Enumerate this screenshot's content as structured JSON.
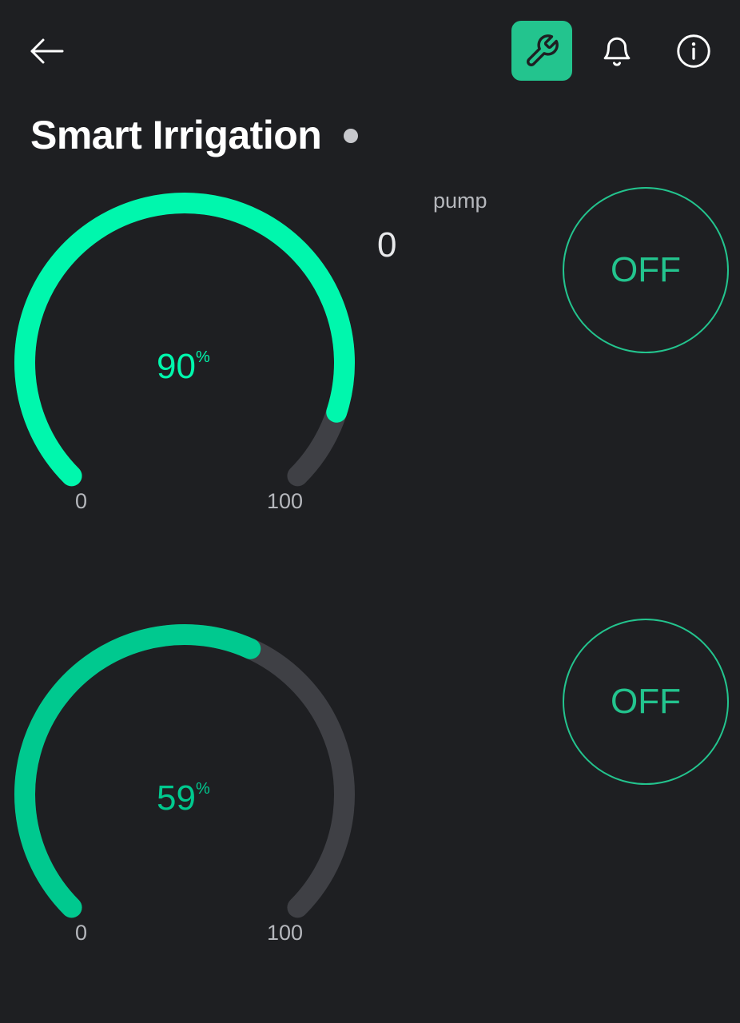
{
  "header": {
    "back_icon": "arrow-left-icon",
    "settings_icon": "wrench-icon",
    "notifications_icon": "bell-icon",
    "info_icon": "info-icon",
    "accent_color": "#23c48e"
  },
  "device": {
    "title": "Smart Irrigation",
    "status_color": "#c7c8cc"
  },
  "pump": {
    "label": "pump",
    "value": "0"
  },
  "gauges": [
    {
      "value": "90",
      "unit": "%",
      "min": "0",
      "max": "100",
      "fraction": 0.9,
      "color": "#00f7ad",
      "track_color": "#3f4045"
    },
    {
      "value": "59",
      "unit": "%",
      "min": "0",
      "max": "100",
      "fraction": 0.59,
      "color": "#00c98f",
      "track_color": "#3f4045"
    }
  ],
  "buttons": [
    {
      "label": "OFF"
    },
    {
      "label": "OFF"
    }
  ]
}
